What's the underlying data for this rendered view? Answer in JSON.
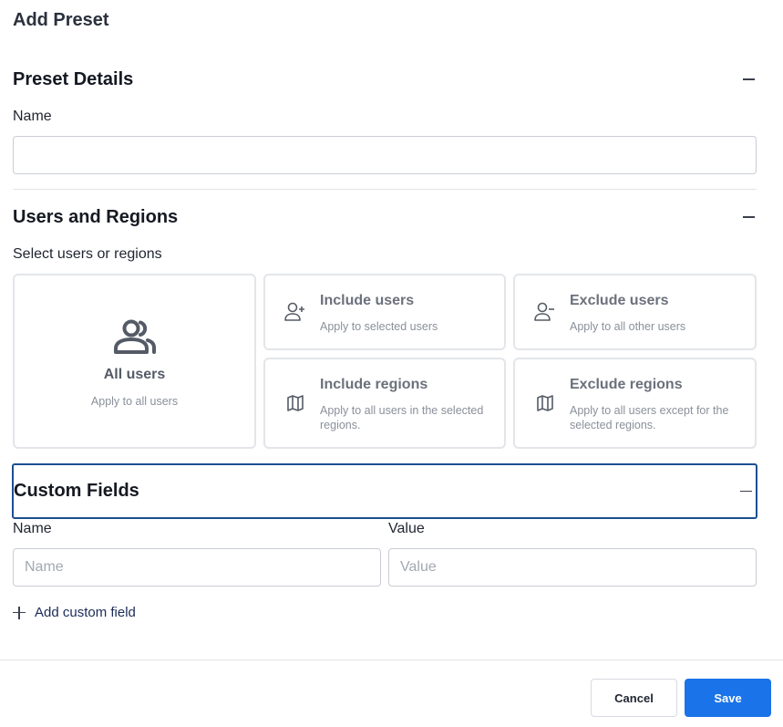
{
  "page": {
    "title": "Add Preset"
  },
  "preset_details": {
    "title": "Preset Details",
    "name_label": "Name",
    "name_value": ""
  },
  "users_regions": {
    "title": "Users and Regions",
    "subtitle": "Select users or regions",
    "all_users": {
      "title": "All users",
      "description": "Apply to all users",
      "icon": "users-group-icon"
    },
    "options": [
      {
        "title": "Include users",
        "description": "Apply to selected users",
        "icon": "user-plus-icon"
      },
      {
        "title": "Exclude users",
        "description": "Apply to all other users",
        "icon": "user-minus-icon"
      },
      {
        "title": "Include regions",
        "description": "Apply to all users in the selected regions.",
        "icon": "map-icon"
      },
      {
        "title": "Exclude regions",
        "description": "Apply to all users except for the selected regions.",
        "icon": "map-icon"
      }
    ]
  },
  "custom_fields": {
    "title": "Custom Fields",
    "name_label": "Name",
    "value_label": "Value",
    "name_placeholder": "Name",
    "value_placeholder": "Value",
    "add_label": "Add custom field"
  },
  "footer": {
    "cancel_label": "Cancel",
    "save_label": "Save"
  },
  "colors": {
    "accent": "#1a73e8",
    "focus_border": "#1c4f91",
    "link": "#1a2b59"
  }
}
